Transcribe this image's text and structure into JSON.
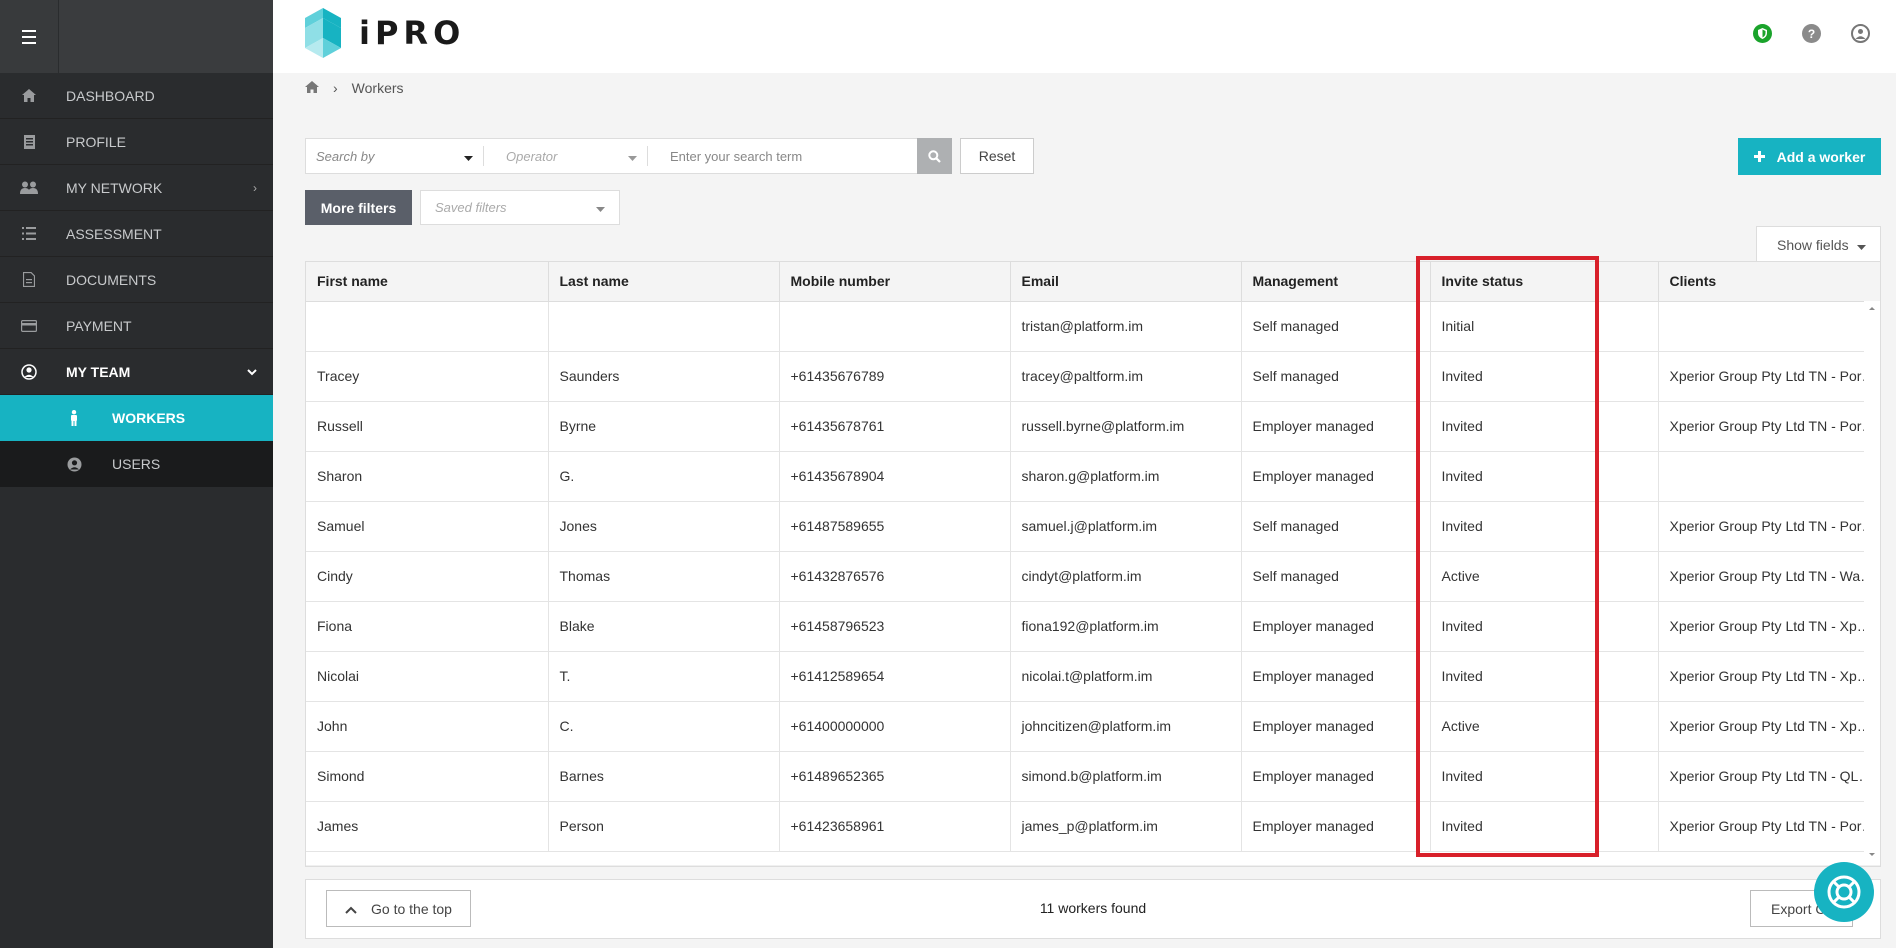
{
  "app": {
    "logo_text": "iPRO"
  },
  "colors": {
    "accent": "#17b3c2",
    "sidebar": "#2a2c2e",
    "highlight": "#d8202a",
    "shield": "#1aa32b"
  },
  "sidebar": {
    "items": [
      {
        "label": "DASHBOARD",
        "icon": "home-icon"
      },
      {
        "label": "PROFILE",
        "icon": "profile-icon"
      },
      {
        "label": "MY NETWORK",
        "icon": "network-icon"
      },
      {
        "label": "ASSESSMENT",
        "icon": "list-icon"
      },
      {
        "label": "DOCUMENTS",
        "icon": "document-icon"
      },
      {
        "label": "PAYMENT",
        "icon": "card-icon"
      },
      {
        "label": "MY TEAM",
        "icon": "team-icon"
      }
    ],
    "sub_items": [
      {
        "label": "WORKERS",
        "icon": "worker-icon"
      },
      {
        "label": "USERS",
        "icon": "user-icon"
      }
    ]
  },
  "breadcrumb": {
    "current": "Workers"
  },
  "search": {
    "search_by": "Search by",
    "operator": "Operator",
    "placeholder": "Enter your search term",
    "reset_label": "Reset",
    "more_filters_label": "More filters",
    "saved_filters": "Saved filters",
    "show_fields_label": "Show fields"
  },
  "add_button_label": "Add a worker",
  "table": {
    "headers": [
      "First name",
      "Last name",
      "Mobile number",
      "Email",
      "Management",
      "Invite status",
      "Clients"
    ],
    "rows": [
      [
        "",
        "",
        "",
        "tristan@platform.im",
        "Self managed",
        "Initial",
        ""
      ],
      [
        "Tracey",
        "Saunders",
        "+61435676789",
        "tracey@paltform.im",
        "Self managed",
        "Invited",
        "Xperior Group Pty Ltd TN - Port Si..."
      ],
      [
        "Russell",
        "Byrne",
        "+61435678761",
        "russell.byrne@platform.im",
        "Employer managed",
        "Invited",
        "Xperior Group Pty Ltd TN - Port Si..."
      ],
      [
        "Sharon",
        "G.",
        "+61435678904",
        "sharon.g@platform.im",
        "Employer managed",
        "Invited",
        ""
      ],
      [
        "Samuel",
        "Jones",
        "+61487589655",
        "samuel.j@platform.im",
        "Self managed",
        "Invited",
        "Xperior Group Pty Ltd TN - Port Si..."
      ],
      [
        "Cindy",
        "Thomas",
        "+61432876576",
        "cindyt@platform.im",
        "Self managed",
        "Active",
        "Xperior Group Pty Ltd TN - Wareh..."
      ],
      [
        "Fiona",
        "Blake",
        "+61458796523",
        "fiona192@platform.im",
        "Employer managed",
        "Invited",
        "Xperior Group Pty Ltd TN - Xperio..."
      ],
      [
        "Nicolai",
        "T.",
        "+61412589654",
        "nicolai.t@platform.im",
        "Employer managed",
        "Invited",
        "Xperior Group Pty Ltd TN - Xperio..."
      ],
      [
        "John",
        "C.",
        "+61400000000",
        "johncitizen@platform.im",
        "Employer managed",
        "Active",
        "Xperior Group Pty Ltd TN - Xperio..."
      ],
      [
        "Simond",
        "Barnes",
        "+61489652365",
        "simond.b@platform.im",
        "Employer managed",
        "Invited",
        "Xperior Group Pty Ltd TN - QLD Br..."
      ],
      [
        "James",
        "Person",
        "+61423658961",
        "james_p@platform.im",
        "Employer managed",
        "Invited",
        "Xperior Group Pty Ltd TN - Port Si..."
      ]
    ]
  },
  "footer": {
    "go_top_label": "Go to the top",
    "found_text": "11 workers found",
    "export_label": "Export C"
  }
}
